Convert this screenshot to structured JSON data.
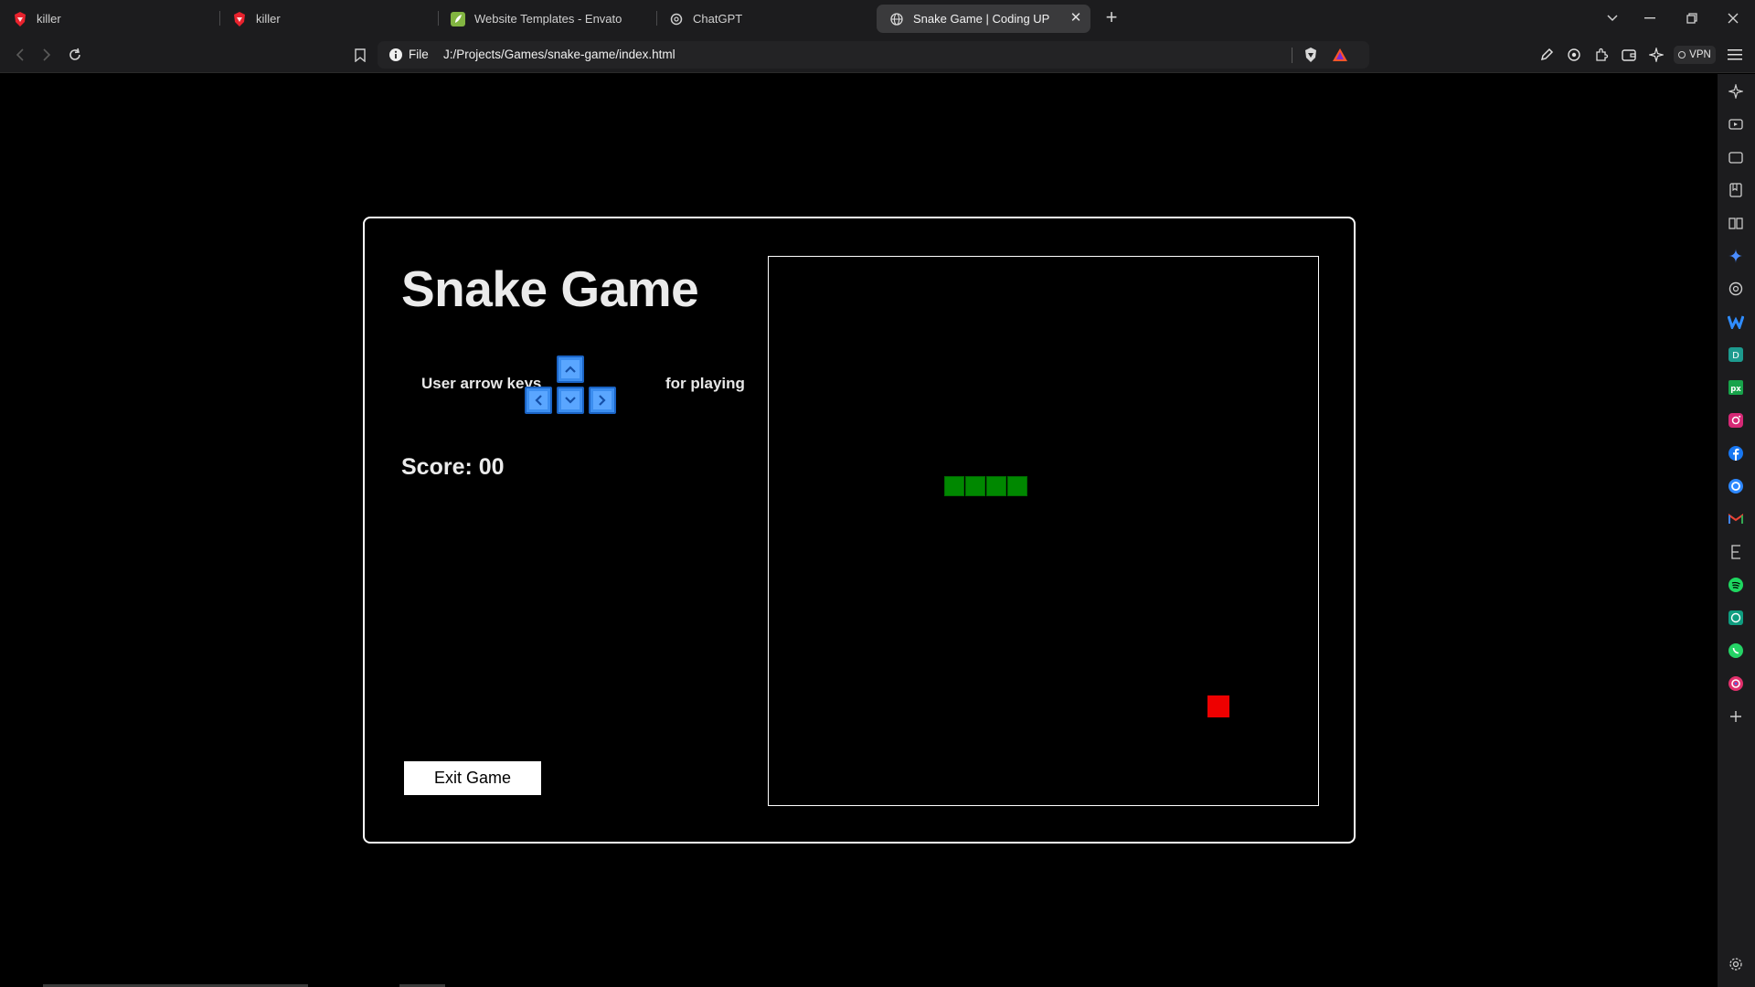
{
  "browser": {
    "tabs": [
      {
        "title": "killer",
        "favicon": "brave-red-icon",
        "active": false
      },
      {
        "title": "killer",
        "favicon": "brave-red-icon",
        "active": false
      },
      {
        "title": "Website Templates - Envato",
        "favicon": "envato-leaf-icon",
        "active": false
      },
      {
        "title": "ChatGPT",
        "favicon": "chatgpt-icon",
        "active": false
      },
      {
        "title": "Snake Game | Coding UP",
        "favicon": "globe-icon",
        "active": true
      }
    ],
    "address_bar": {
      "scheme_label": "File",
      "url": "J:/Projects/Games/snake-game/index.html"
    },
    "vpn_label": "VPN",
    "colors": {
      "chrome_bg": "#1c1c1e",
      "active_tab": "#3a3a3c",
      "brave_red": "#fb542b"
    }
  },
  "game": {
    "title": "Snake Game",
    "instructions_left": "User arrow keys",
    "instructions_right": "for playing",
    "score_label": "Score: 00",
    "exit_button_label": "Exit Game",
    "snake_color": "#008800",
    "food_color": "#ee0000",
    "key_color": "#3c8ef0"
  }
}
